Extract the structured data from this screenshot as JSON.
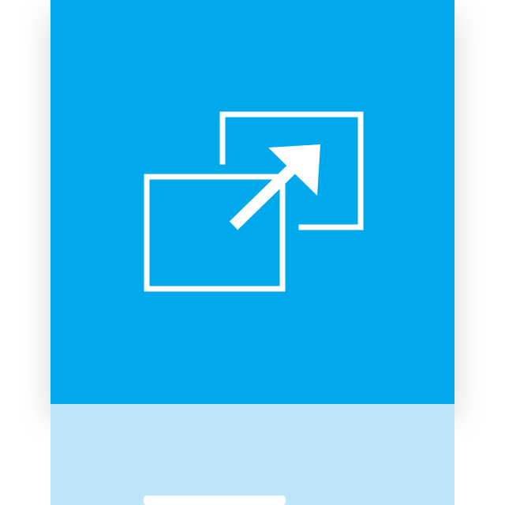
{
  "icon": {
    "name": "switch-window-icon",
    "tile_color": "#00a8ec",
    "glyph_color": "#ffffff",
    "reflection_color": "#bee6f9"
  }
}
